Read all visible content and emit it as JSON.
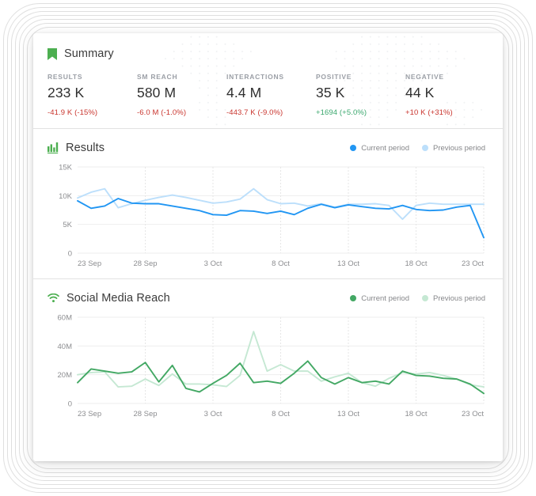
{
  "summary": {
    "icon": "bookmark-icon",
    "title": "Summary",
    "accent_color": "#4caf50",
    "stats": [
      {
        "label": "RESULTS",
        "value": "233 K",
        "delta": "-41.9 K (-15%)",
        "direction": "negative"
      },
      {
        "label": "SM REACH",
        "value": "580 M",
        "delta": "-6.0 M (-1.0%)",
        "direction": "negative"
      },
      {
        "label": "INTERACTIONS",
        "value": "4.4 M",
        "delta": "-443.7 K (-9.0%)",
        "direction": "negative"
      },
      {
        "label": "POSITIVE",
        "value": "35 K",
        "delta": "+1694 (+5.0%)",
        "direction": "positive"
      },
      {
        "label": "NEGATIVE",
        "value": "44 K",
        "delta": "+10 K (+31%)",
        "direction": "negative"
      }
    ]
  },
  "results_card": {
    "icon": "bar-chart-icon",
    "title": "Results",
    "legend": [
      {
        "label": "Current period",
        "color": "#2196f3"
      },
      {
        "label": "Previous period",
        "color": "#bcdffb"
      }
    ]
  },
  "social_card": {
    "icon": "wifi-icon",
    "title": "Social Media Reach",
    "legend": [
      {
        "label": "Current period",
        "color": "#43a864"
      },
      {
        "label": "Previous period",
        "color": "#c5e8d3"
      }
    ]
  },
  "chart_data": [
    {
      "type": "line",
      "title": "Results",
      "xlabel": "",
      "ylabel": "",
      "ylim": [
        0,
        15000
      ],
      "yticks": [
        0,
        5000,
        10000,
        15000
      ],
      "ytick_labels": [
        "0",
        "5K",
        "10K",
        "15K"
      ],
      "grid": true,
      "legend_position": "top-right",
      "x": [
        "23 Sep",
        "24 Sep",
        "25 Sep",
        "26 Sep",
        "27 Sep",
        "28 Sep",
        "29 Sep",
        "30 Sep",
        "1 Oct",
        "2 Oct",
        "3 Oct",
        "4 Oct",
        "5 Oct",
        "6 Oct",
        "7 Oct",
        "8 Oct",
        "9 Oct",
        "10 Oct",
        "11 Oct",
        "12 Oct",
        "13 Oct",
        "14 Oct",
        "15 Oct",
        "16 Oct",
        "17 Oct",
        "18 Oct",
        "19 Oct",
        "20 Oct",
        "21 Oct",
        "22 Oct",
        "23 Oct"
      ],
      "xtick_labels": [
        "23 Sep",
        "28 Sep",
        "3 Oct",
        "8 Oct",
        "13 Oct",
        "18 Oct",
        "23 Oct"
      ],
      "xtick_indices": [
        0,
        5,
        10,
        15,
        20,
        25,
        30
      ],
      "series": [
        {
          "name": "Current period",
          "color": "#2196f3",
          "values": [
            9100,
            7800,
            8200,
            9500,
            8700,
            8600,
            8600,
            8200,
            7800,
            7400,
            6700,
            6600,
            7400,
            7300,
            6900,
            7300,
            6700,
            7800,
            8500,
            7900,
            8400,
            8100,
            7800,
            7700,
            8300,
            7600,
            7400,
            7500,
            8000,
            8300,
            2700
          ]
        },
        {
          "name": "Previous period",
          "color": "#bcdffb",
          "values": [
            9600,
            10600,
            11200,
            7900,
            8600,
            9200,
            9700,
            10100,
            9700,
            9200,
            8700,
            8900,
            9400,
            11200,
            9300,
            8600,
            8700,
            8200,
            8600,
            8000,
            8500,
            8500,
            8600,
            8300,
            5900,
            8300,
            8700,
            8500,
            8500,
            8500,
            8500
          ]
        }
      ]
    },
    {
      "type": "line",
      "title": "Social Media Reach",
      "xlabel": "",
      "ylabel": "",
      "ylim": [
        0,
        60000000
      ],
      "yticks": [
        0,
        20000000,
        40000000,
        60000000
      ],
      "ytick_labels": [
        "0",
        "20M",
        "40M",
        "60M"
      ],
      "grid": true,
      "legend_position": "top-right",
      "x": [
        "23 Sep",
        "24 Sep",
        "25 Sep",
        "26 Sep",
        "27 Sep",
        "28 Sep",
        "29 Sep",
        "30 Sep",
        "1 Oct",
        "2 Oct",
        "3 Oct",
        "4 Oct",
        "5 Oct",
        "6 Oct",
        "7 Oct",
        "8 Oct",
        "9 Oct",
        "10 Oct",
        "11 Oct",
        "12 Oct",
        "13 Oct",
        "14 Oct",
        "15 Oct",
        "16 Oct",
        "17 Oct",
        "18 Oct",
        "19 Oct",
        "20 Oct",
        "21 Oct",
        "22 Oct",
        "23 Oct"
      ],
      "xtick_labels": [
        "23 Sep",
        "28 Sep",
        "3 Oct",
        "8 Oct",
        "13 Oct",
        "18 Oct",
        "23 Oct"
      ],
      "xtick_indices": [
        0,
        5,
        10,
        15,
        20,
        25,
        30
      ],
      "series": [
        {
          "name": "Current period",
          "color": "#43a864",
          "values": [
            14500,
            24000,
            22500,
            21000,
            22000,
            28500,
            15000,
            26500,
            10500,
            8000,
            14000,
            19500,
            28000,
            14500,
            15500,
            14000,
            21000,
            29500,
            18000,
            13500,
            18000,
            14500,
            15500,
            13500,
            22500,
            19500,
            19000,
            17500,
            17000,
            13500,
            7000
          ],
          "scale_note": "values in thousands (K) — 28500 = 28.5M"
        },
        {
          "name": "Previous period",
          "color": "#c5e8d3",
          "values": [
            20000,
            21500,
            22000,
            11500,
            12000,
            17000,
            12500,
            20500,
            13500,
            13500,
            13000,
            11800,
            19500,
            50000,
            22500,
            27000,
            22500,
            22500,
            15500,
            18500,
            21000,
            14500,
            12000,
            17500,
            21500,
            20500,
            21500,
            19500,
            17000,
            13000,
            11500
          ],
          "scale_note": "values in thousands (K) — 50000 = 50M"
        }
      ]
    }
  ]
}
